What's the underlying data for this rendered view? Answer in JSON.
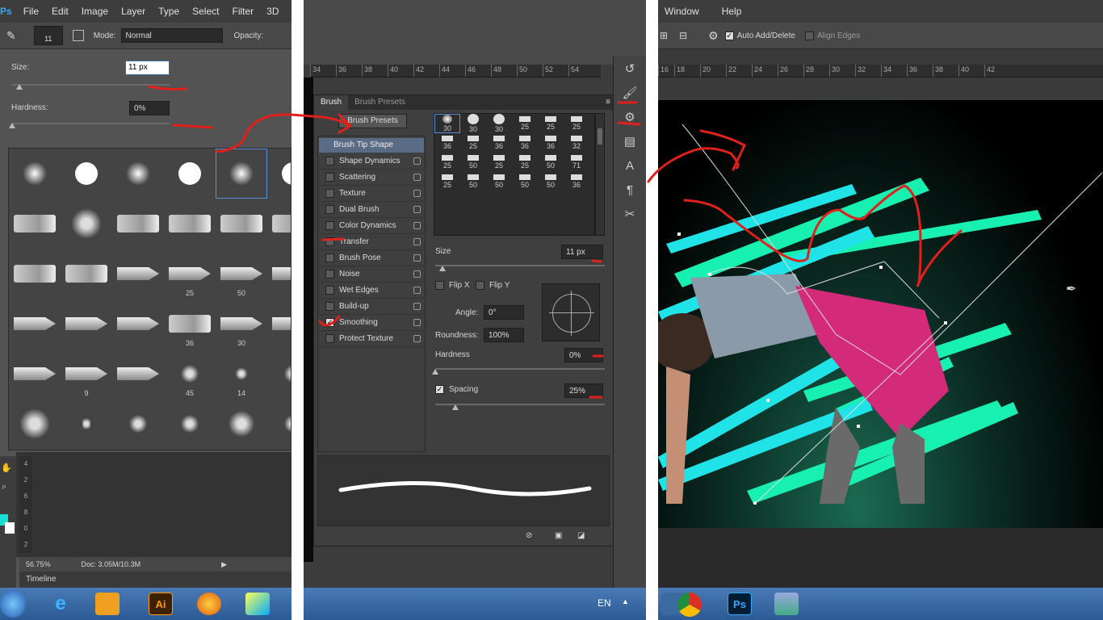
{
  "left": {
    "menu": [
      "File",
      "Edit",
      "Image",
      "Layer",
      "Type",
      "Select",
      "Filter",
      "3D"
    ],
    "options": {
      "brush_size": "11",
      "mode_label": "Mode:",
      "mode_value": "Normal",
      "opacity_label": "Opacity:"
    },
    "size_label": "Size:",
    "size_value": "11 px",
    "hardness_label": "Hardness:",
    "hardness_value": "0%",
    "brush_numbers": [
      "25",
      "50",
      "36",
      "30",
      "9",
      "45",
      "14"
    ],
    "status": {
      "zoom": "56.75%",
      "doc": "Doc: 3.05M/10.3M"
    },
    "timeline_tab": "Timeline",
    "rulers": [
      "4",
      "2",
      "6",
      "8",
      "0",
      "2"
    ]
  },
  "middle": {
    "ruler": [
      "34",
      "36",
      "38",
      "40",
      "42",
      "44",
      "46",
      "48",
      "50",
      "52",
      "54"
    ],
    "tabs": {
      "brush": "Brush",
      "presets": "Brush Presets"
    },
    "presets_button": "Brush Presets",
    "tip_shape": "Brush Tip Shape",
    "options": [
      "Shape Dynamics",
      "Scattering",
      "Texture",
      "Dual Brush",
      "Color Dynamics",
      "Transfer",
      "Brush Pose",
      "Noise",
      "Wet Edges",
      "Build-up",
      "Smoothing",
      "Protect Texture"
    ],
    "tip_numbers": [
      "30",
      "30",
      "30",
      "25",
      "25",
      "25",
      "36",
      "25",
      "36",
      "36",
      "36",
      "32",
      "25",
      "50",
      "25",
      "25",
      "50",
      "71",
      "25",
      "50",
      "50",
      "50",
      "50",
      "36"
    ],
    "size_label": "Size",
    "size_value": "11 px",
    "flip_x": "Flip X",
    "flip_y": "Flip Y",
    "angle_label": "Angle:",
    "angle_value": "0°",
    "roundness_label": "Roundness:",
    "roundness_value": "100%",
    "hardness_label": "Hardness",
    "hardness_value": "0%",
    "spacing_label": "Spacing",
    "spacing_value": "25%",
    "lang": "EN"
  },
  "right": {
    "menu": [
      "Window",
      "Help"
    ],
    "auto_add": "Auto Add/Delete",
    "align_edges": "Align Edges",
    "ruler": [
      "16",
      "18",
      "20",
      "22",
      "24",
      "26",
      "28",
      "30",
      "32",
      "34",
      "36",
      "38",
      "40",
      "42"
    ]
  },
  "taskbar": {
    "ai": "Ai",
    "ps": "Ps"
  },
  "logo_ps": "Ps"
}
